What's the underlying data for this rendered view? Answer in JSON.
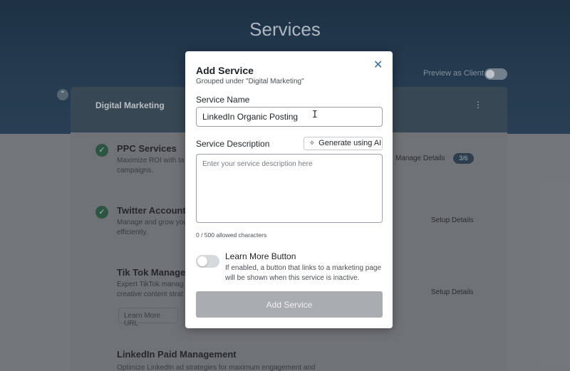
{
  "page": {
    "title": "Services",
    "preview_label": "Preview as Client"
  },
  "card": {
    "title": "Digital Marketing",
    "menu_glyph": "⋮"
  },
  "services": [
    {
      "name": "PPC Services",
      "desc_line1": "Maximize ROI with ta",
      "desc_line2": "campaigns.",
      "action": "Manage Details",
      "badge": "3/6"
    },
    {
      "name": "Twitter Account",
      "desc_line1": "Manage and grow you",
      "desc_line2": "efficiently.",
      "action": "Setup Details"
    },
    {
      "name": "Tik Tok Manager",
      "desc_line1": "Expert TikTok manag",
      "desc_line2": "creative content strat",
      "action": "Setup Details",
      "button": "Learn More URL"
    },
    {
      "name": "LinkedIn Paid Management",
      "desc_line1": "Optimize LinkedIn ad strategies for maximum engagement and"
    }
  ],
  "modal": {
    "title": "Add Service",
    "subtitle": "Grouped under \"Digital Marketing\"",
    "close_glyph": "✕",
    "name_label": "Service Name",
    "name_value": "LinkedIn Organic Posting",
    "desc_label": "Service Description",
    "generate_label": "Generate using AI",
    "desc_placeholder": "Enter your service description here",
    "char_count": "0 / 500 allowed characters",
    "learn_more_title": "Learn More Button",
    "learn_more_desc": "If enabled, a button that links to a marketing page will be shown when this service is inactive.",
    "learn_more_enabled": false,
    "submit_label": "Add Service"
  },
  "icons": {
    "close": "close-icon",
    "sparkle": "sparkle-icon",
    "check": "check-circle-icon",
    "kebab": "kebab-menu-icon"
  }
}
